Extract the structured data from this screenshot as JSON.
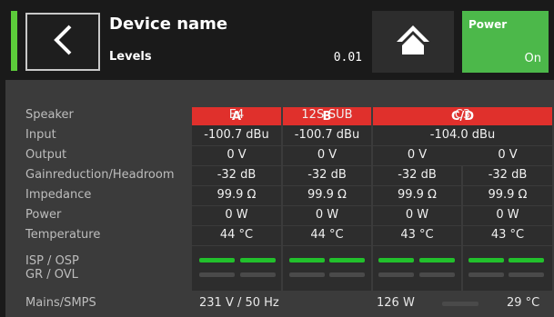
{
  "header": {
    "title": "Device name",
    "subtitle": "Levels",
    "level_value": "0.01",
    "power_label": "Power",
    "power_state": "On",
    "colors": {
      "status": "#5ccc3a",
      "power": "#4cb84a",
      "channel_head": "#e0302c",
      "led_on": "#22c02c"
    }
  },
  "channels": [
    "A",
    "B",
    "C/D"
  ],
  "rows": {
    "labels": [
      "Speaker",
      "Input",
      "Output",
      "Gainreduction/Headroom",
      "Impedance",
      "Power",
      "Temperature"
    ],
    "speaker": [
      "E4",
      "12S-SUB",
      "C3"
    ],
    "input": [
      "-100.7 dBu",
      "-100.7 dBu",
      "-104.0 dBu"
    ],
    "output": [
      "0 V",
      "0 V",
      "0 V",
      "0 V"
    ],
    "gain": [
      "-32 dB",
      "-32 dB",
      "-32 dB",
      "-32 dB"
    ],
    "impedance": [
      "99.9 Ω",
      "99.9 Ω",
      "99.9 Ω",
      "99.9 Ω"
    ],
    "power": [
      "0 W",
      "0 W",
      "0 W",
      "0 W"
    ],
    "temperature": [
      "44 °C",
      "44 °C",
      "43 °C",
      "43 °C"
    ]
  },
  "indicators": {
    "isp_label": "ISP / OSP",
    "gr_label": "GR / OVL"
  },
  "mains": {
    "label": "Mains/SMPS",
    "voltage": "231 V / 50 Hz",
    "power": "126 W",
    "temperature": "29 °C"
  }
}
